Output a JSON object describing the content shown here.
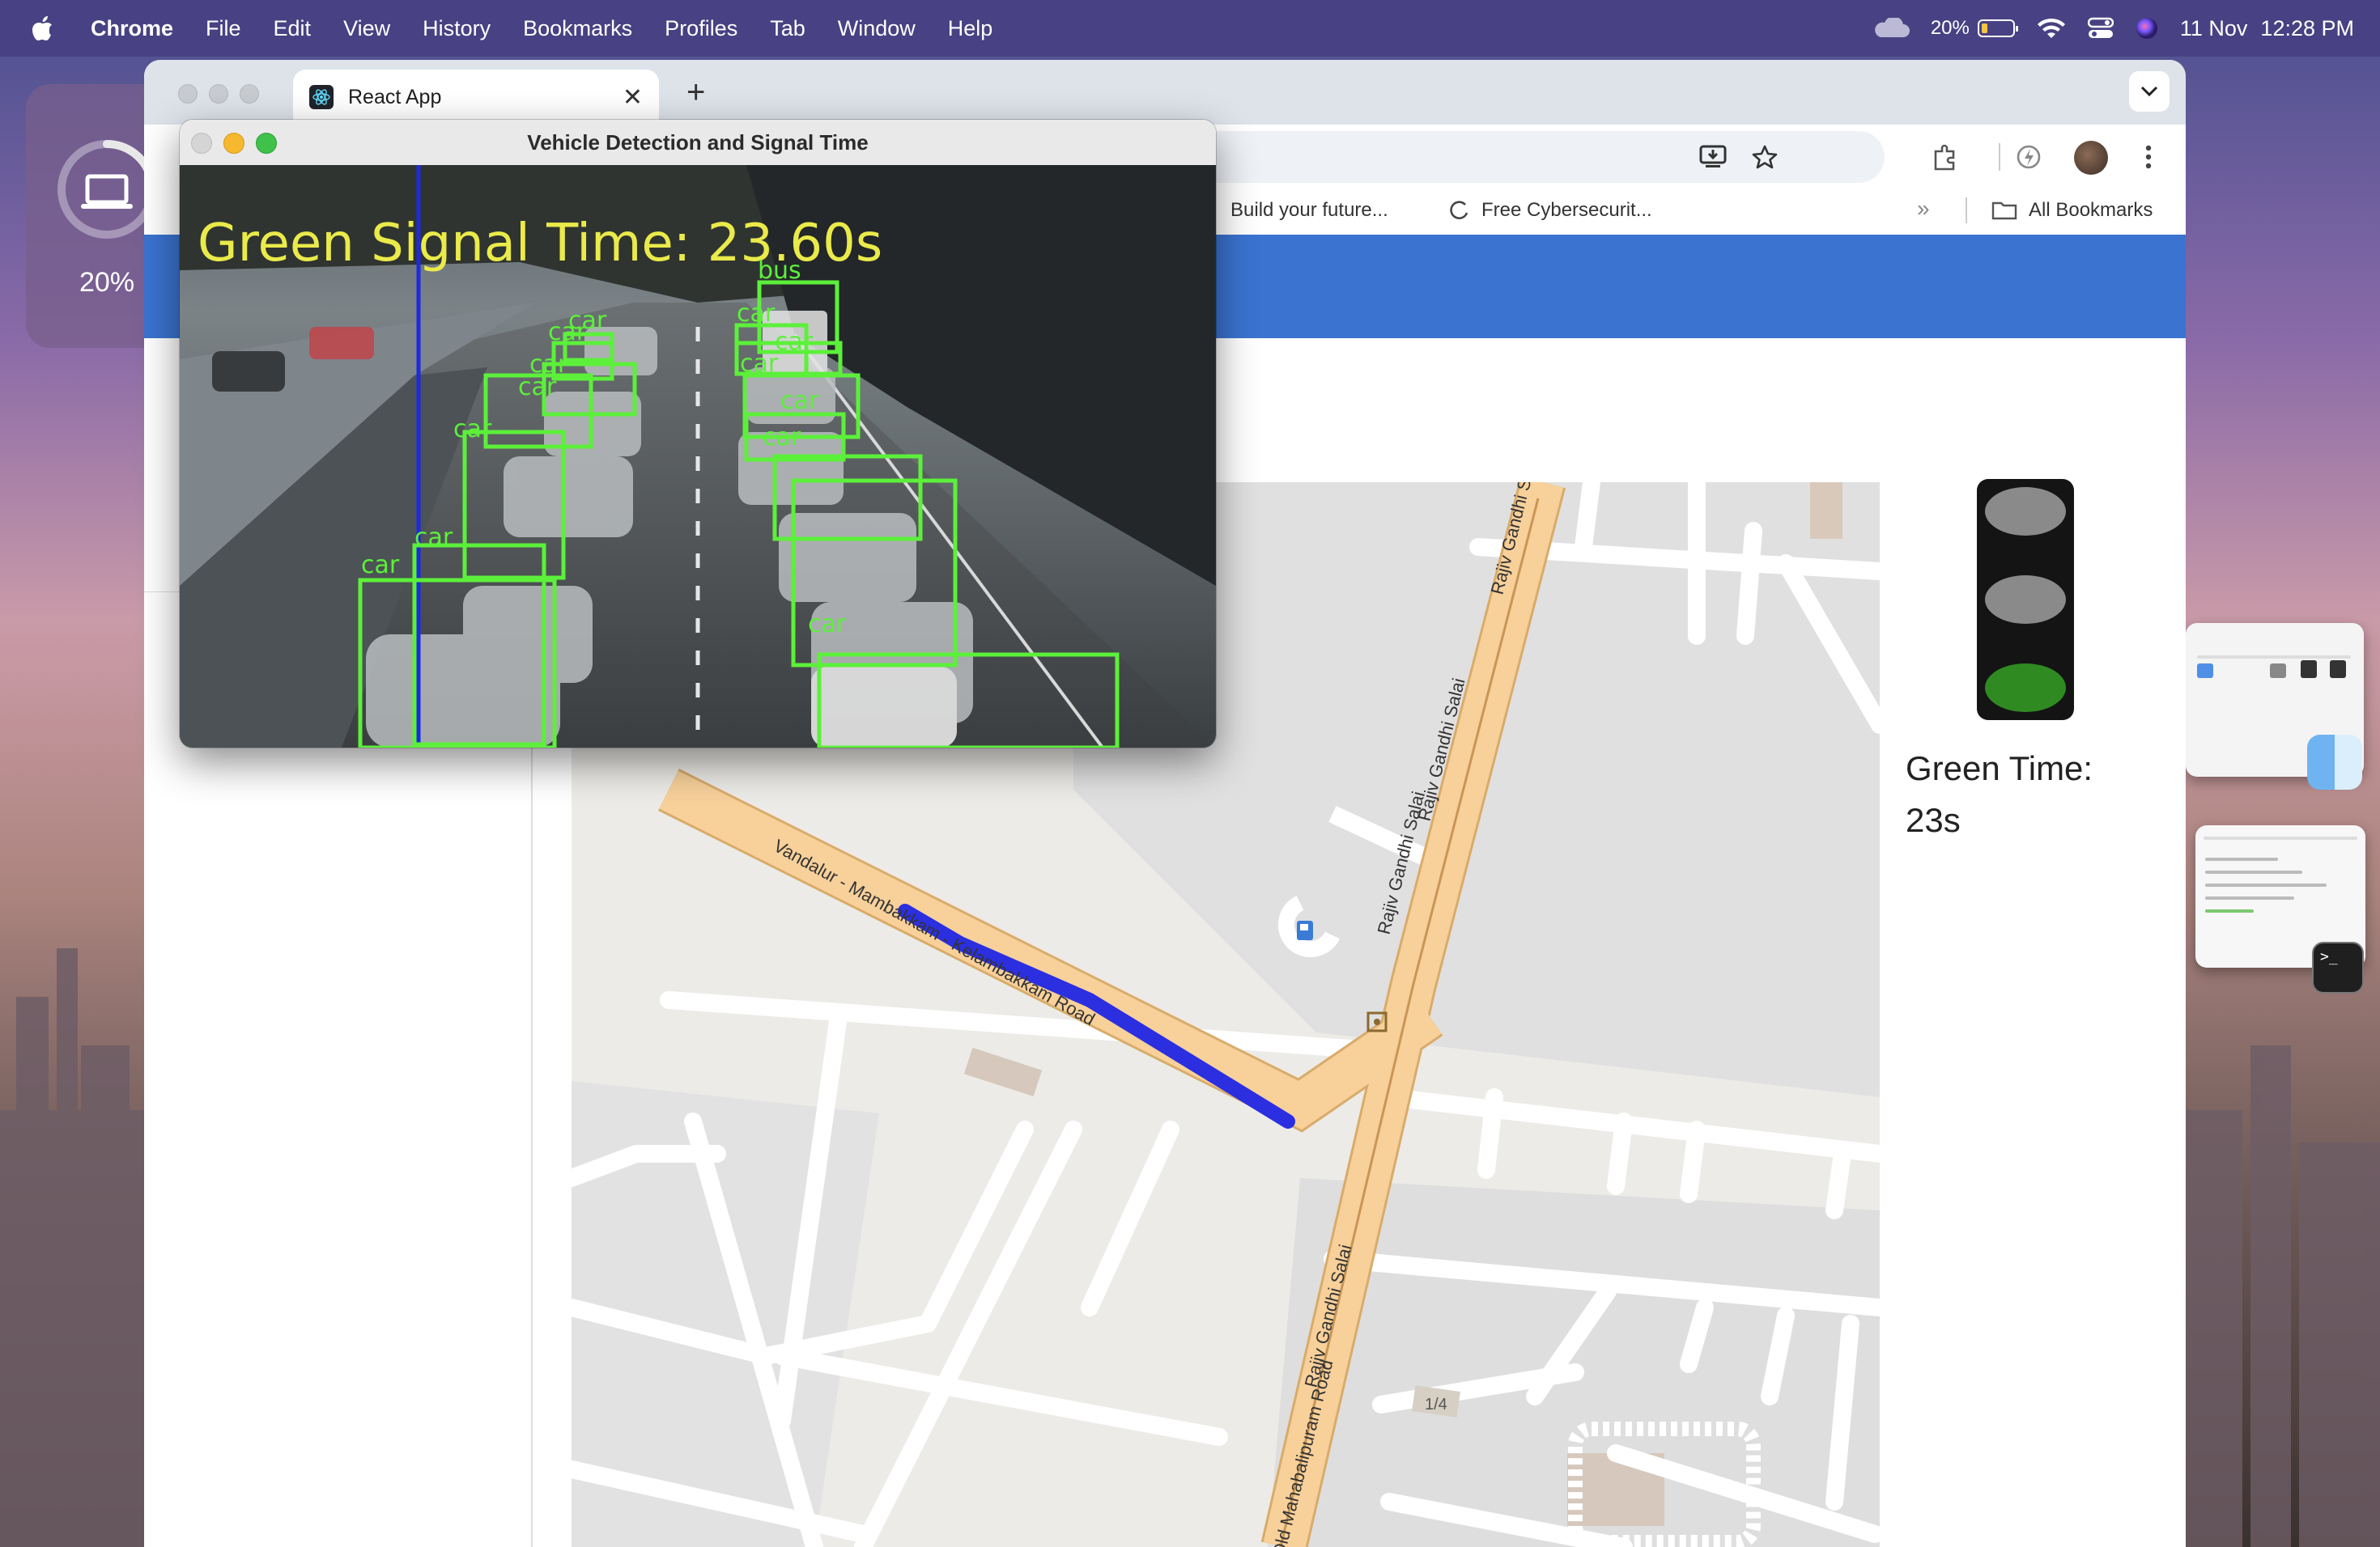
{
  "menubar": {
    "app_name": "Chrome",
    "items": [
      "File",
      "Edit",
      "View",
      "History",
      "Bookmarks",
      "Profiles",
      "Tab",
      "Window",
      "Help"
    ],
    "battery_percent": "20%",
    "date": "11 Nov",
    "time": "12:28 PM"
  },
  "battery_widget": {
    "percent": "20%",
    "level": 0.2
  },
  "browser": {
    "tab_title": "React App",
    "new_tab": "+",
    "bookmarks": {
      "item1": "Build your future...",
      "item2": "Free Cybersecurit...",
      "overflow": "»",
      "all": "All Bookmarks"
    }
  },
  "cv_window": {
    "title": "Vehicle Detection and Signal Time",
    "overlay_text": "Green Signal Time: 23.60s",
    "labels": [
      "bus",
      "car",
      "car",
      "car",
      "car",
      "car",
      "car",
      "car",
      "car",
      "car",
      "car",
      "car",
      "car",
      "car"
    ]
  },
  "map": {
    "road1": "Vandalur - Mambakkam - Kelambakkam Road",
    "road2": "Rajiv Gandhi Salai",
    "road3": "Rajiv Gandhi Salai",
    "road4": "Rajiv Gandhi Salai",
    "road5": "Rajiv Gandhi Salai",
    "road6": "Old Mahabalipuram Road",
    "marker": "1/4"
  },
  "signal": {
    "active": "green",
    "green_label": "Green Time:",
    "green_value": "23s",
    "colors": {
      "off": "#8a8a8a",
      "green": "#2f8a22",
      "housing": "#141414"
    }
  },
  "colors": {
    "appbar": "#3a73d0",
    "route": "#2b2fe0",
    "road": "#f7d09a",
    "detection_box": "#5cf03a",
    "overlay_text": "#eaea4a"
  }
}
